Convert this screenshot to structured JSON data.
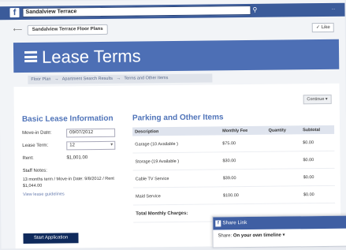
{
  "browser": {
    "search_value": "Sandalview Terrace",
    "search_icon": "search-icon",
    "right_text": "..."
  },
  "chips": {
    "page_chip": "Sandalview Terrace  Floor Plans",
    "like_label": "✓ Like"
  },
  "banner": {
    "title": "Lease Terms",
    "menu_icon": "menu-icon"
  },
  "breadcrumb": [
    "Floor Plan",
    "→",
    "Apartment Search Results",
    "→",
    "Terms and Other Items"
  ],
  "toolbar": {
    "button_label": "Continue ▾"
  },
  "basic": {
    "heading": "Basic Lease Information",
    "move_in_label": "Move-in Date:",
    "move_in_value": "09/07/2012",
    "lease_term_label": "Lease Term:",
    "lease_term_value": "12",
    "rent_label": "Rent:",
    "rent_value": "$1,001.00",
    "staff_label": "Staff Notes:",
    "staff_text": "13 months term / Move-in Date: 9/8/2012 / Rent $1,044.00",
    "view_link": "View lease guidelines",
    "start_button": "Start Application"
  },
  "parking": {
    "heading": "Parking and Other Items",
    "columns": [
      "Description",
      "Monthly Fee",
      "Quantity",
      "Subtotal"
    ],
    "rows": [
      {
        "description": "Garage (10 Available )",
        "fee": "$75.00",
        "qty": "",
        "subtotal": "$0.00"
      },
      {
        "description": "Storage (19 Available )",
        "fee": "$30.00",
        "qty": "",
        "subtotal": "$0.00"
      },
      {
        "description": "Cable TV Service",
        "fee": "$39.00",
        "qty": "",
        "subtotal": "$0.00"
      },
      {
        "description": "Maid Service",
        "fee": "$100.00",
        "qty": "",
        "subtotal": "$0.00"
      }
    ],
    "total_label": "Total Monthly Charges:"
  },
  "popup": {
    "title": "Share Link",
    "share_label": "Share:",
    "share_value": "On your own timeline",
    "chevron": "▾"
  },
  "colors": {
    "fb_blue": "#3b5b9a",
    "banner_blue": "#4d6fb5",
    "heading_blue": "#5074b9",
    "button_navy": "#0f2a5c"
  }
}
